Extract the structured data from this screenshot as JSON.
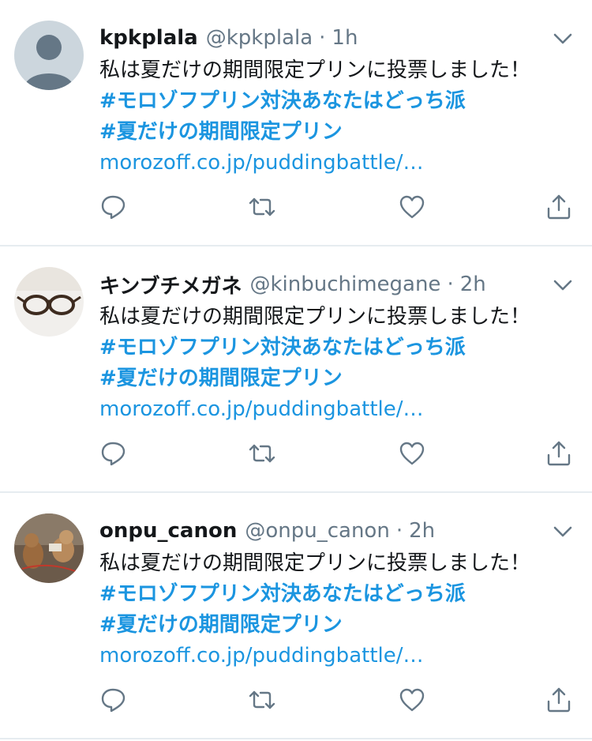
{
  "tweets": [
    {
      "name": "kpkplala",
      "handle": "@kpkplala",
      "separator": "·",
      "time": "1h",
      "text": "私は夏だけの期間限定プリンに投票しました！",
      "hashtags": [
        "#モロゾフプリン対決あなたはどっち派",
        "#夏だけの期間限定プリン"
      ],
      "link": "morozoff.co.jp/puddingbattle/…",
      "avatar": "default-avatar"
    },
    {
      "name": "キンブチメガネ",
      "handle": "@kinbuchimegane",
      "separator": "·",
      "time": "2h",
      "text": "私は夏だけの期間限定プリンに投票しました！",
      "hashtags": [
        "#モロゾフプリン対決あなたはどっち派",
        "#夏だけの期間限定プリン"
      ],
      "link": "morozoff.co.jp/puddingbattle/…",
      "avatar": "glasses-photo"
    },
    {
      "name": "onpu_canon",
      "handle": "@onpu_canon",
      "separator": "·",
      "time": "2h",
      "text": "私は夏だけの期間限定プリンに投票しました！",
      "hashtags": [
        "#モロゾフプリン対決あなたはどっち派",
        "#夏だけの期間限定プリン"
      ],
      "link": "morozoff.co.jp/puddingbattle/…",
      "avatar": "dog-toy-photo"
    }
  ],
  "colors": {
    "accent": "#1b95e0",
    "secondary_text": "#657786",
    "primary_text": "#14171a",
    "divider": "#e6ecf0"
  },
  "icons": {
    "reply": "reply-icon",
    "retweet": "retweet-icon",
    "like": "heart-icon",
    "share": "share-icon",
    "more": "chevron-down-icon"
  }
}
